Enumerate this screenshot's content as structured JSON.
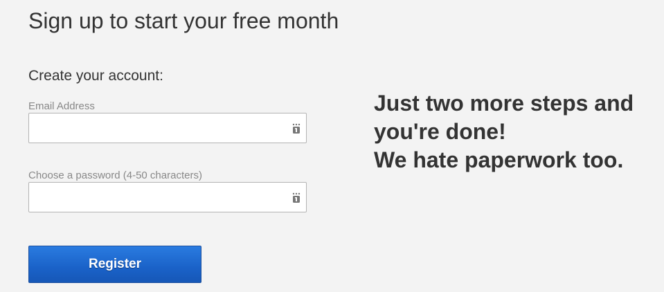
{
  "header": {
    "title": "Sign up to start your free month"
  },
  "form": {
    "heading": "Create your account:",
    "email": {
      "label": "Email Address",
      "value": "",
      "placeholder": "",
      "icon": "keychain-autofill-icon"
    },
    "password": {
      "label": "Choose a password (4-50 characters)",
      "value": "",
      "placeholder": "",
      "icon": "keychain-autofill-icon"
    },
    "register_label": "Register"
  },
  "promo": {
    "lines": [
      "Just two more steps and",
      "you're done!",
      "We hate paperwork too."
    ]
  },
  "colors": {
    "background": "#f3f3f3",
    "text": "#333333",
    "label": "#888888",
    "button": "#1a62c8",
    "button_text": "#ffffff"
  }
}
